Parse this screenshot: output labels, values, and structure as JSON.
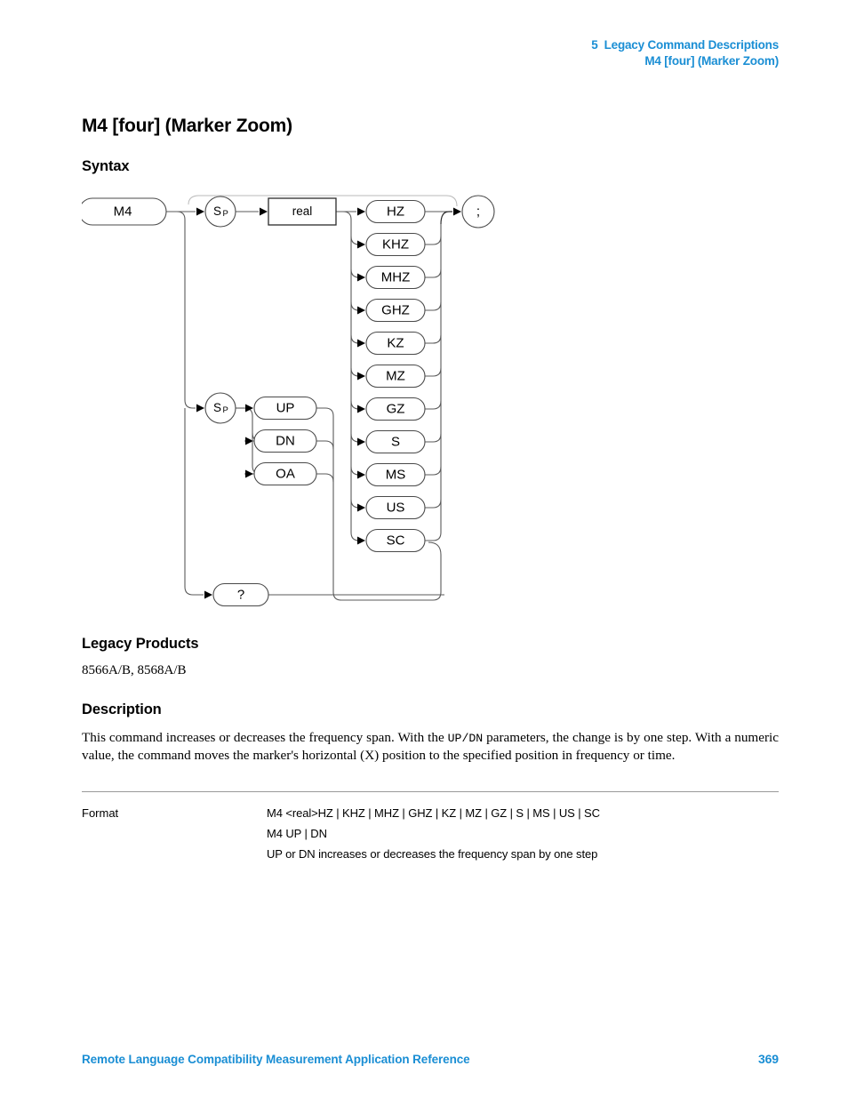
{
  "header": {
    "line1": "5  Legacy Command Descriptions",
    "line2": "M4 [four] (Marker Zoom)",
    "color": "#1a8ed4"
  },
  "title": "M4 [four] (Marker Zoom)",
  "sections": {
    "syntax_heading": "Syntax",
    "legacy_heading": "Legacy Products",
    "legacy_products": "8566A/B, 8568A/B",
    "description_heading": "Description",
    "description_part1": "This command increases or decreases the frequency span. With the ",
    "description_mono": "UP/DN",
    "description_part2": " parameters, the change is by one step. With a numeric value, the command moves the marker's horizontal (X) position to the specified position in frequency or time."
  },
  "diagram": {
    "command_node": "M4",
    "space_node": "S",
    "space_sub": "P",
    "real_node": "real",
    "terminator_node": ";",
    "query_node": "?",
    "units": [
      "HZ",
      "KHZ",
      "MHZ",
      "GHZ",
      "KZ",
      "MZ",
      "GZ",
      "S",
      "MS",
      "US",
      "SC"
    ],
    "step_keywords": [
      "UP",
      "DN",
      "OA"
    ]
  },
  "format_table": {
    "label": "Format",
    "rows": [
      "M4 <real>HZ | KHZ | MHZ | GHZ | KZ | MZ | GZ | S | MS | US | SC",
      "M4 UP | DN",
      "UP or DN increases or decreases the frequency span by one step"
    ]
  },
  "footer": {
    "text": "Remote Language Compatibility Measurement Application Reference",
    "page_number": "369"
  }
}
